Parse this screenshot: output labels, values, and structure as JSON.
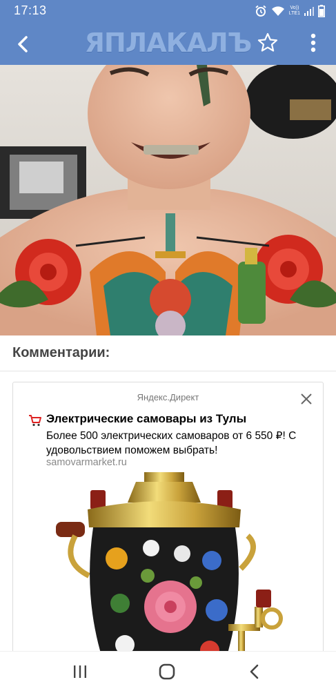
{
  "status_bar": {
    "time": "17:13",
    "network_label_top": "Vo))",
    "network_label_bottom": "LTE1",
    "icons": [
      "alarm-icon",
      "wifi-icon",
      "signal-icon",
      "battery-icon"
    ]
  },
  "header": {
    "logo_text": "ЯПЛАКАЛЪ",
    "icons": [
      "back-arrow-icon",
      "star-icon",
      "more-vert-icon"
    ],
    "background_color": "#5f87c6"
  },
  "comments": {
    "title": "Комментарии:"
  },
  "ad": {
    "source": "Яндекс.Директ",
    "title": "Электрические самовары из Тулы",
    "text": "Более 500 электрических самоваров от 6 550 ₽! С удовольствием поможем выбрать!",
    "domain": "samovarmarket.ru",
    "icons": [
      "cart-icon",
      "close-icon"
    ]
  },
  "nav_bar": {
    "icons": [
      "recent-apps-icon",
      "home-icon",
      "back-icon"
    ]
  }
}
